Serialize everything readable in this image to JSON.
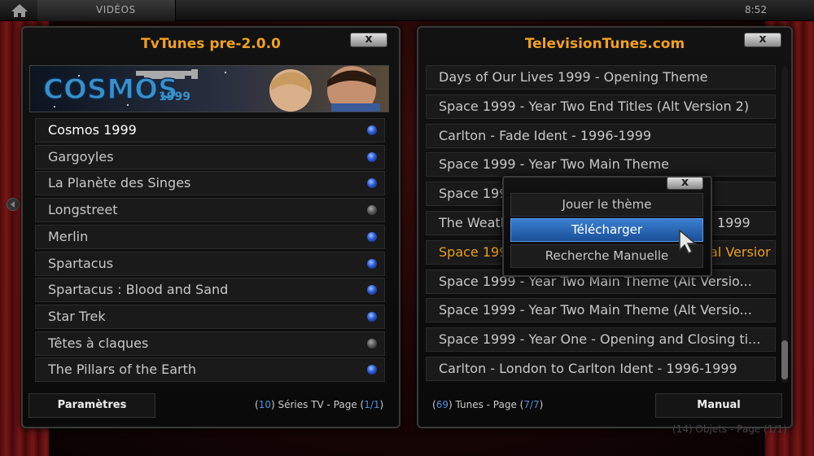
{
  "topbar": {
    "section": "VIDÉOS",
    "clock": "8:52"
  },
  "left_dialog": {
    "title": "TvTunes pre-2.0.0",
    "close": "x",
    "banner_text": "COSMOS 1999",
    "items": [
      {
        "label": "Cosmos 1999",
        "dot": "blue"
      },
      {
        "label": "Gargoyles",
        "dot": "blue"
      },
      {
        "label": "La Planète des Singes",
        "dot": "blue"
      },
      {
        "label": "Longstreet",
        "dot": "grey"
      },
      {
        "label": "Merlin",
        "dot": "blue"
      },
      {
        "label": "Spartacus",
        "dot": "blue"
      },
      {
        "label": "Spartacus : Blood and Sand",
        "dot": "blue"
      },
      {
        "label": "Star Trek",
        "dot": "blue"
      },
      {
        "label": "Têtes à claques",
        "dot": "grey"
      },
      {
        "label": "The Pillars of the Earth",
        "dot": "blue"
      }
    ],
    "settings_button": "Paramètres",
    "footer": {
      "count": "10",
      "label": "Séries TV - Page",
      "page": "1/1"
    }
  },
  "right_dialog": {
    "title": "TelevisionTunes.com",
    "close": "x",
    "items": [
      "Days of Our Lives 1999 - Opening Theme",
      "Space 1999 - Year Two End Titles (Alt Version 2)",
      "Carlton - Fade Ident - 1996-1999",
      "Space 1999 - Year Two Main Theme",
      "Space 1999",
      "The Weath",
      "Space 1999",
      "Space 1999 - Year Two Main Theme (Alt Versio...",
      "Space 1999 - Year Two Main Theme (Alt Versio...",
      "Space 1999 - Year One - Opening and Closing ti...",
      "Carlton - London to Carlton Ident - 1996-1999"
    ],
    "item5_tail": "1999",
    "item6_tail": "al Versior",
    "manual_button": "Manual",
    "footer": {
      "count": "69",
      "label": "Tunes - Page",
      "page": "7/7"
    }
  },
  "context_menu": {
    "close": "x",
    "items": [
      "Jouer le thème",
      "Télécharger",
      "Recherche Manuelle"
    ]
  },
  "background_footer": "(14) Objets - Page (1/1)",
  "colors": {
    "accent": "#f0a020",
    "highlight": "#e8a020",
    "blue_text": "#4a8ee0",
    "selection": "#2a6ab8"
  }
}
